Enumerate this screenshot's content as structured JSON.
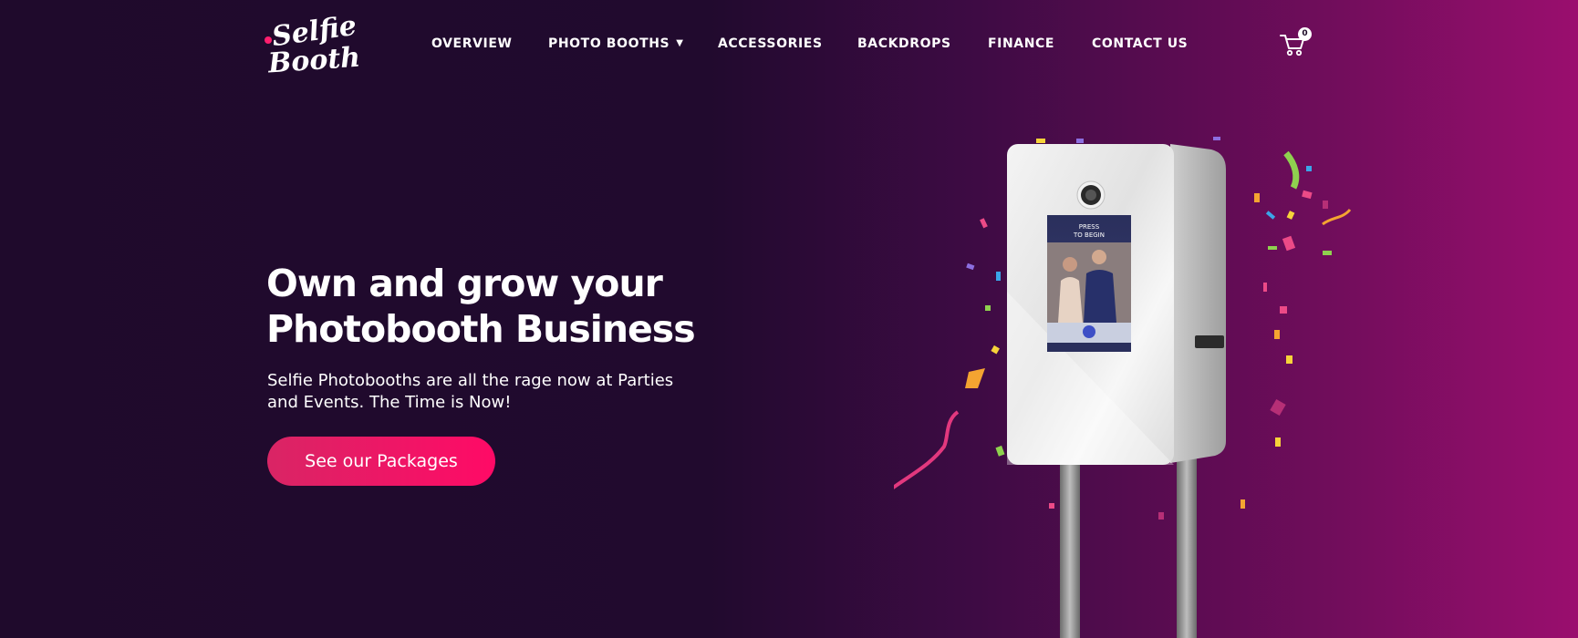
{
  "brand": {
    "logo_line1": "Selfie",
    "logo_line2": "Booth"
  },
  "nav": {
    "items": [
      {
        "label": "OVERVIEW"
      },
      {
        "label": "PHOTO BOOTHS",
        "has_dropdown": true
      },
      {
        "label": "ACCESSORIES"
      },
      {
        "label": "BACKDROPS"
      },
      {
        "label": "FINANCE"
      },
      {
        "label": "CONTACT US"
      }
    ],
    "dropdown_icon": "chevron-down-icon"
  },
  "cart": {
    "icon": "cart-icon",
    "count": "0"
  },
  "hero": {
    "title_line1": "Own and grow your",
    "title_line2": "Photobooth Business",
    "subtitle": "Selfie Photobooths are all the rage now at Parties and Events. The Time is Now!",
    "cta_label": "See our Packages"
  },
  "booth_screen": {
    "line1": "PRESS",
    "line2": "TO BEGIN"
  },
  "colors": {
    "background_left": "#1f0a2c",
    "background_right": "#9a0e6e",
    "cta_start": "#d92565",
    "cta_end": "#ff0a66",
    "text": "#ffffff"
  }
}
